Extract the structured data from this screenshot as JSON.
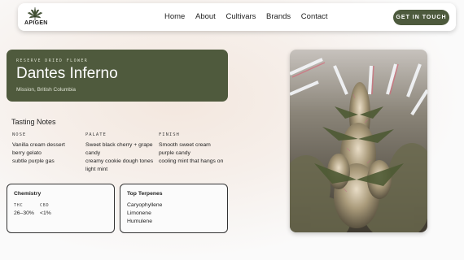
{
  "nav": {
    "logo_text": "APIGEN",
    "links": [
      "Home",
      "About",
      "Cultivars",
      "Brands",
      "Contact"
    ],
    "cta": "GET IN TOUCH"
  },
  "hero": {
    "eyebrow": "RESERVE DRIED FLOWER",
    "title": "Dantes Inferno",
    "location": "Mission, British Columbia"
  },
  "tasting": {
    "title": "Tasting Notes",
    "columns": [
      {
        "label": "NOSE",
        "lines": [
          "Vanilla cream dessert",
          "berry gelato",
          "subtle purple gas"
        ]
      },
      {
        "label": "PALATE",
        "lines": [
          "Sweet black cherry + grape",
          "candy",
          "creamy cookie dough tones",
          "light mint"
        ]
      },
      {
        "label": "FINISH",
        "lines": [
          "Smooth sweet cream",
          "purple candy",
          "cooling mint that hangs on"
        ]
      }
    ]
  },
  "chemistry": {
    "title": "Chemistry",
    "thc_label": "THC",
    "thc_value": "26–30%",
    "cbd_label": "CBD",
    "cbd_value": "<1%"
  },
  "terpenes": {
    "title": "Top Terpenes",
    "items": [
      "Caryophyllene",
      "Limonene",
      "Humulene"
    ]
  },
  "colors": {
    "brand": "#4f5a3d",
    "cta": "#4d5a3d"
  },
  "photo": {
    "subject": "cannabis-plant-grow-room"
  }
}
